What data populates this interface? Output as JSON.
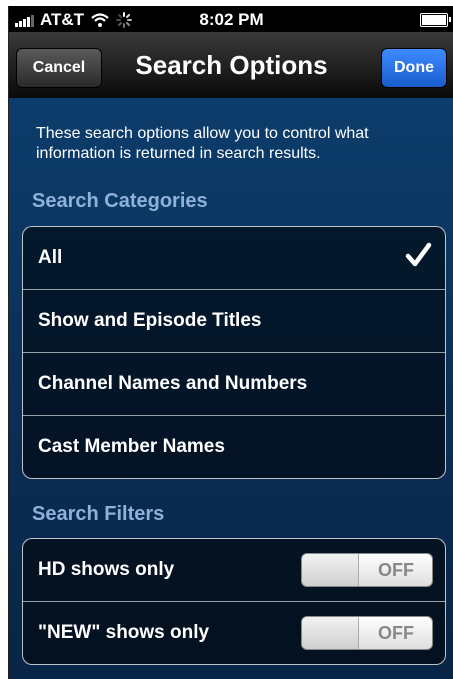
{
  "status_bar": {
    "carrier": "AT&T",
    "time": "8:02 PM"
  },
  "nav": {
    "title": "Search Options",
    "cancel_label": "Cancel",
    "done_label": "Done"
  },
  "intro_text": "These search options allow you to control what information is returned in search results.",
  "categories": {
    "header": "Search Categories",
    "items": [
      {
        "label": "All",
        "selected": true
      },
      {
        "label": "Show and Episode Titles",
        "selected": false
      },
      {
        "label": "Channel Names and Numbers",
        "selected": false
      },
      {
        "label": "Cast Member Names",
        "selected": false
      }
    ]
  },
  "filters": {
    "header": "Search Filters",
    "items": [
      {
        "label": "HD shows only",
        "state": "OFF"
      },
      {
        "label": "\"NEW\" shows only",
        "state": "OFF"
      }
    ]
  },
  "colors": {
    "background_blue": "#0a2f57",
    "section_header": "#8fb0d8",
    "done_button": "#2a72e6"
  }
}
